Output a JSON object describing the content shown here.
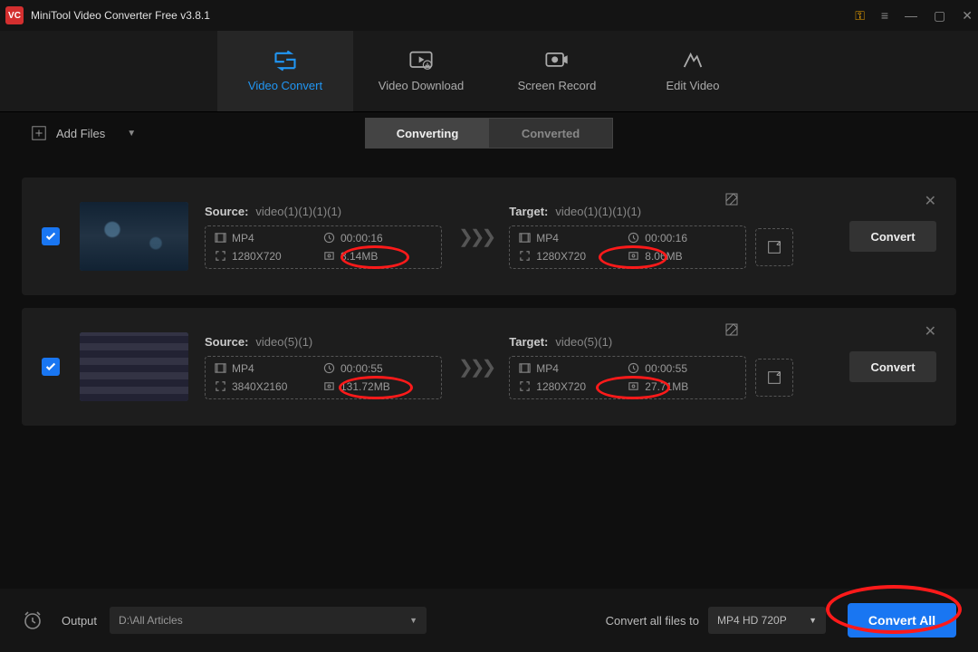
{
  "app": {
    "title": "MiniTool Video Converter Free v3.8.1",
    "logo_text": "VC"
  },
  "nav": {
    "convert": "Video Convert",
    "download": "Video Download",
    "record": "Screen Record",
    "edit": "Edit Video"
  },
  "toolbar": {
    "add_files": "Add Files"
  },
  "subtabs": {
    "converting": "Converting",
    "converted": "Converted"
  },
  "labels": {
    "source": "Source:",
    "target": "Target:"
  },
  "buttons": {
    "convert": "Convert"
  },
  "rows": [
    {
      "source_name": "video(1)(1)(1)(1)",
      "target_name": "video(1)(1)(1)(1)",
      "src": {
        "fmt": "MP4",
        "dur": "00:00:16",
        "res": "1280X720",
        "size": "8.14MB"
      },
      "tgt": {
        "fmt": "MP4",
        "dur": "00:00:16",
        "res": "1280X720",
        "size": "8.06MB"
      }
    },
    {
      "source_name": "video(5)(1)",
      "target_name": "video(5)(1)",
      "src": {
        "fmt": "MP4",
        "dur": "00:00:55",
        "res": "3840X2160",
        "size": "131.72MB"
      },
      "tgt": {
        "fmt": "MP4",
        "dur": "00:00:55",
        "res": "1280X720",
        "size": "27.71MB"
      }
    }
  ],
  "footer": {
    "output_label": "Output",
    "output_path": "D:\\All Articles",
    "convert_all_label": "Convert all files to",
    "format": "MP4 HD 720P",
    "convert_all_btn": "Convert All"
  }
}
